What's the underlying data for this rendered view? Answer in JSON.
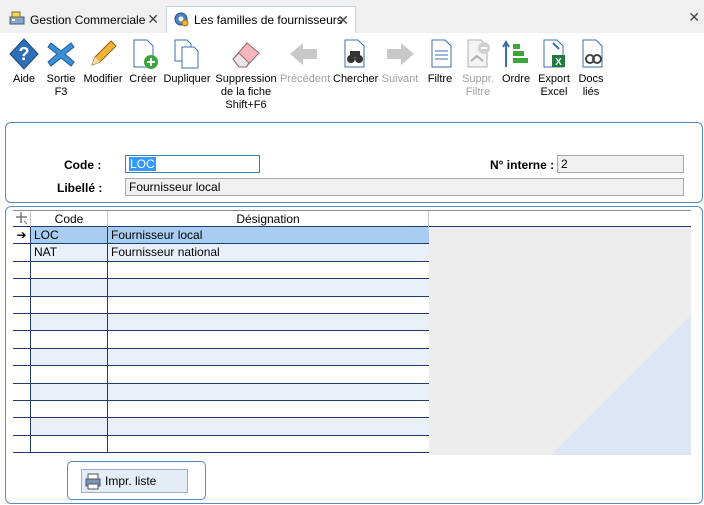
{
  "tabs": [
    {
      "label": "Gestion Commerciale",
      "icon": "cash-register-icon"
    },
    {
      "label": "Les familles de fournisseurs",
      "icon": "gear-blue-icon"
    }
  ],
  "toolbar": {
    "aide": "Aide",
    "sortie": "Sortie\nF3",
    "modifier": "Modifier",
    "creer": "Créer",
    "dupliquer": "Dupliquer",
    "suppression": "Suppression\nde la fiche\nShift+F6",
    "precedent": "Précédent",
    "chercher": "Chercher",
    "suivant": "Suivant",
    "filtre": "Filtre",
    "suppr_filtre": "Suppr.\nFiltre",
    "ordre": "Ordre",
    "export_excel": "Export\nExcel",
    "docs_lies": "Docs\nliés"
  },
  "form": {
    "code_label": "Code :",
    "code_value": "LOC",
    "libelle_label": "Libellé :",
    "libelle_value": "Fournisseur local",
    "num_interne_label": "N° interne :",
    "num_interne_value": "2"
  },
  "grid": {
    "columns": [
      "Code",
      "Désignation"
    ],
    "rows": [
      {
        "code": "LOC",
        "designation": "Fournisseur local",
        "selected": true
      },
      {
        "code": "NAT",
        "designation": "Fournisseur national",
        "selected": false
      }
    ],
    "empty_rows": 11
  },
  "print_button": {
    "label": "Impr. liste"
  },
  "colors": {
    "accent": "#5b8ac0",
    "selection": "#a9cdf0",
    "row_alt": "#e9f0fa",
    "text_selection": "#3399ff"
  }
}
